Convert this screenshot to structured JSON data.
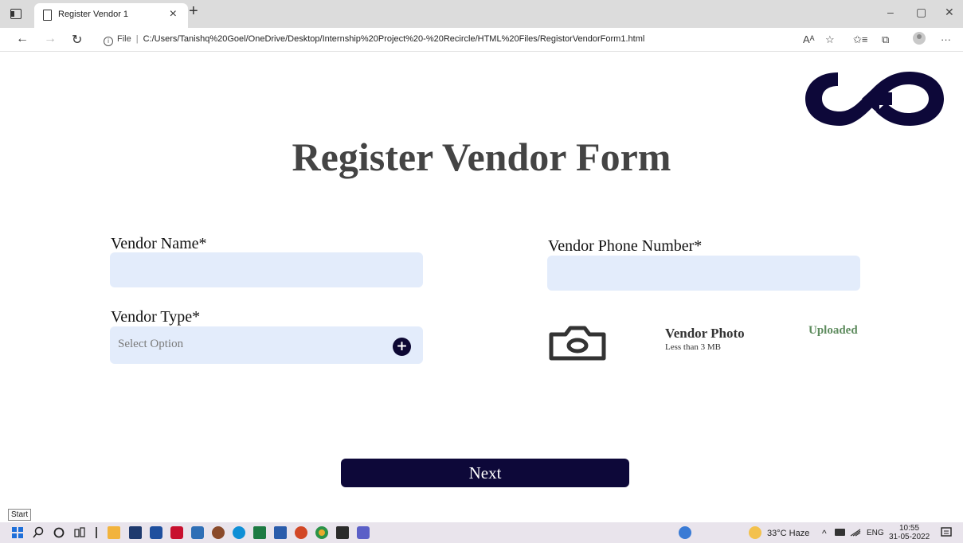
{
  "browser": {
    "tab_title": "Register Vendor 1",
    "tab_close": "×",
    "new_tab": "+",
    "window_controls": {
      "minimize": "–",
      "restore": "▢",
      "close": "✕"
    },
    "nav": {
      "back": "←",
      "forward": "→",
      "refresh": "↻"
    },
    "address": {
      "info_glyph": "i",
      "scheme_label": "File",
      "separator": "|",
      "url": "C:/Users/Tanishq%20Goel/OneDrive/Desktop/Internship%20Project%20-%20Recircle/HTML%20Files/RegistorVendorForm1.html"
    },
    "toolbar": {
      "read_aloud": "Aᴬ",
      "favorite": "☆",
      "favorites": "✩≡",
      "collections": "⧉",
      "more": "···"
    }
  },
  "page": {
    "title": "Register Vendor Form",
    "logo_icon": "recircle-infinity-logo",
    "brand_color": "#0d0839",
    "vendor_name": {
      "label": "Vendor Name*",
      "value": ""
    },
    "vendor_phone": {
      "label": "Vendor Phone Number*",
      "value": ""
    },
    "vendor_type": {
      "label": "Vendor Type*",
      "placeholder": "Select Option",
      "icon": "plus-circle-icon"
    },
    "vendor_photo": {
      "icon": "camera-icon",
      "title": "Vendor Photo",
      "hint": "Less than 3 MB",
      "status": "Uploaded",
      "status_color": "#5d8b5d"
    },
    "next_button": "Next"
  },
  "taskbar": {
    "start_tooltip": "Start",
    "weather": "33°C  Haze",
    "tray_arrow": "^",
    "language": "ENG",
    "time": "10:55",
    "date": "31-05-2022"
  }
}
